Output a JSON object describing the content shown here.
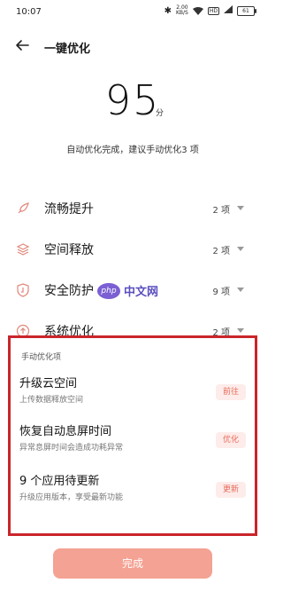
{
  "status": {
    "time": "10:07",
    "speed_top": "2.00",
    "speed_bottom": "KB/S",
    "hd": "HD",
    "battery": "61"
  },
  "header": {
    "title": "一键优化"
  },
  "score": {
    "value": "95",
    "unit": "分"
  },
  "summary": "自动优化完成，建议手动优化3 项",
  "categories": [
    {
      "label": "流畅提升",
      "count": "2 项"
    },
    {
      "label": "空间释放",
      "count": "2 项"
    },
    {
      "label": "安全防护",
      "count": "9 项"
    },
    {
      "label": "系统优化",
      "count": "2 项"
    }
  ],
  "watermark": {
    "logo": "php",
    "text": "中文网"
  },
  "manual": {
    "title": "手动优化项",
    "items": [
      {
        "title": "升级云空间",
        "subtitle": "上传数据释放空间",
        "action": "前往"
      },
      {
        "title": "恢复自动息屏时间",
        "subtitle": "异常息屏时间会造成功耗异常",
        "action": "优化"
      },
      {
        "title": "9 个应用待更新",
        "subtitle": "升级应用版本，享受最新功能",
        "action": "更新"
      }
    ]
  },
  "done_label": "完成",
  "colors": {
    "accent": "#e86b5a",
    "button": "#f4a293",
    "highlight": "#c9252b"
  }
}
